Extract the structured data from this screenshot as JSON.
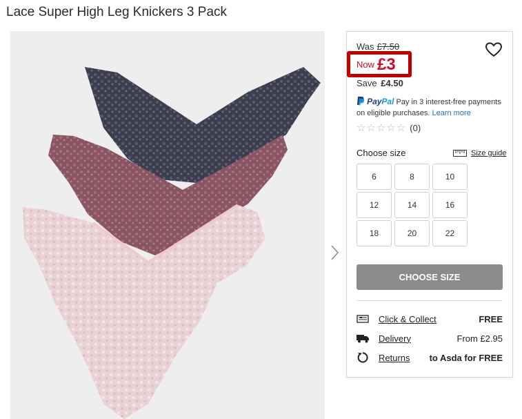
{
  "product": {
    "title": "Lace Super High Leg Knickers 3 Pack"
  },
  "gallery": {
    "next_icon": "chevron-right-icon"
  },
  "price": {
    "was_label": "Was",
    "was_value": "£7.50",
    "now_label": "Now",
    "now_value": "£3",
    "save_label": "Save",
    "save_value": "£4.50",
    "highlight_color": "#c00000",
    "now_color": "#c8102e"
  },
  "wishlist": {
    "icon": "heart-icon"
  },
  "paypal": {
    "brand_pay": "Pay",
    "brand_pal": "Pal",
    "message": "Pay in 3 interest-free payments on eligible purchases.",
    "link": "Learn more"
  },
  "rating": {
    "stars": 0,
    "count": "(0)"
  },
  "size": {
    "label": "Choose size",
    "guide": "Size guide",
    "options": [
      "6",
      "8",
      "10",
      "12",
      "14",
      "16",
      "18",
      "20",
      "22"
    ]
  },
  "cta": {
    "label": "CHOOSE SIZE",
    "color": "#8b8b8b"
  },
  "delivery": [
    {
      "icon": "store-icon",
      "label": "Click & Collect",
      "value": "FREE"
    },
    {
      "icon": "truck-icon",
      "label": "Delivery",
      "value": "From £2.95"
    },
    {
      "icon": "returns-icon",
      "label": "Returns",
      "value": "to Asda for FREE"
    }
  ]
}
